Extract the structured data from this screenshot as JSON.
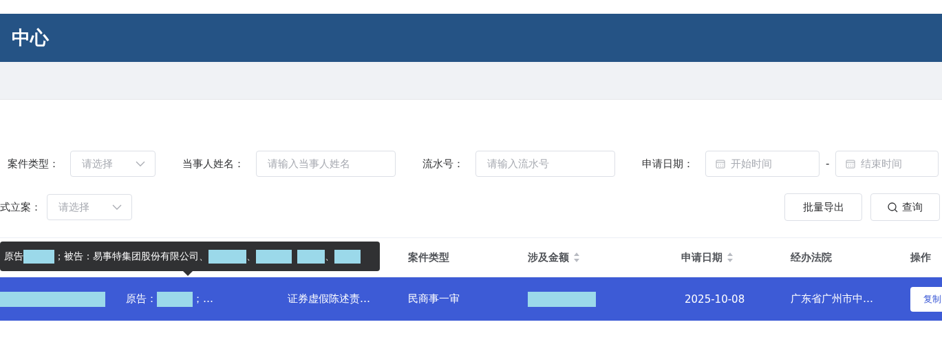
{
  "header": {
    "title": "中心"
  },
  "filters": [
    {
      "label": "案件类型：",
      "kind": "select",
      "placeholder": "请选择"
    },
    {
      "label": "当事人姓名：",
      "kind": "input",
      "placeholder": "请输入当事人姓名"
    },
    {
      "label": "流水号：",
      "kind": "input",
      "placeholder": "请输入流水号"
    },
    {
      "label": "申请日期：",
      "kind": "daterange",
      "placeholder": "开始时间",
      "placeholder_end": "结束时间",
      "separator": "-"
    }
  ],
  "filters_row2": [
    {
      "label": "式立案：",
      "kind": "select",
      "placeholder": "请选择"
    }
  ],
  "actions": [
    {
      "label": "批量导出",
      "kind": "plain"
    },
    {
      "label": "查询",
      "kind": "search"
    }
  ],
  "table": {
    "columns": [
      {
        "label": "案件类型"
      },
      {
        "label": "涉及金额",
        "sortable": true
      },
      {
        "label": "申请日期",
        "sortable": true
      },
      {
        "label": "经办法院"
      },
      {
        "label": "操作"
      }
    ],
    "rows": [
      {
        "selected": true,
        "cells_under_tooltip": [
          {
            "kind": "redacted"
          },
          {
            "kind": "parties",
            "prefix": "原告：",
            "suffix": "；…"
          },
          {
            "kind": "text",
            "text": "证券虚假陈述责…"
          }
        ],
        "cells": [
          {
            "kind": "text",
            "text": "民商事一审"
          },
          {
            "kind": "redacted"
          },
          {
            "kind": "text",
            "text": "2025-10-08"
          },
          {
            "kind": "text",
            "text": "广东省广州市中…"
          },
          {
            "kind": "button",
            "text": "复制"
          }
        ]
      }
    ]
  },
  "tooltip": {
    "segments": [
      {
        "kind": "text",
        "text": "原告"
      },
      {
        "kind": "redacted"
      },
      {
        "kind": "text",
        "text": "；被告：易事特集团股份有限公司、"
      },
      {
        "kind": "redacted"
      },
      {
        "kind": "text",
        "text": "、"
      },
      {
        "kind": "redacted"
      },
      {
        "kind": "redacted"
      },
      {
        "kind": "text",
        "text": "、"
      },
      {
        "kind": "redacted"
      }
    ]
  }
}
